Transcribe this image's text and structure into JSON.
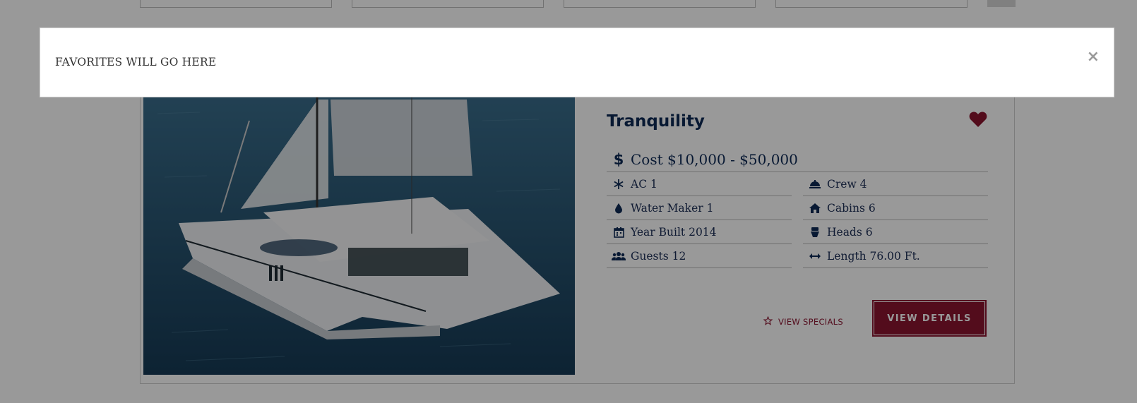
{
  "modal": {
    "text": "FAVORITES WILL GO HERE",
    "close_label": "×"
  },
  "yacht": {
    "name": "Tranquility",
    "favorite_icon": "heart-icon",
    "cost": "Cost $10,000 - $50,000",
    "specs": [
      {
        "icon": "snowflake-icon",
        "label": "AC 1"
      },
      {
        "icon": "concierge-bell-icon",
        "label": "Crew 4"
      },
      {
        "icon": "water-drop-icon",
        "label": "Water Maker 1"
      },
      {
        "icon": "home-icon",
        "label": "Cabins 6"
      },
      {
        "icon": "calendar-icon",
        "label": "Year Built 2014"
      },
      {
        "icon": "toilet-icon",
        "label": "Heads 6"
      },
      {
        "icon": "users-icon",
        "label": "Guests 12"
      },
      {
        "icon": "arrows-horizontal-icon",
        "label": "Length 76.00 Ft."
      }
    ],
    "specials_label": "VIEW SPECIALS",
    "details_label": "VIEW DETAILS"
  },
  "colors": {
    "navy": "#0e2a55",
    "accent": "#8a1430",
    "backdrop": "rgba(0,0,0,0.4)"
  }
}
